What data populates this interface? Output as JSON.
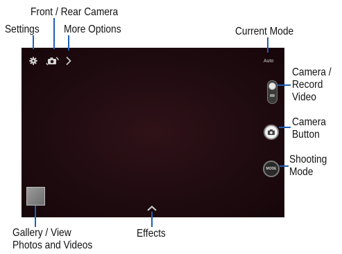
{
  "callouts": {
    "front_rear_camera": "Front / Rear Camera",
    "settings": "Settings",
    "more_options": "More Options",
    "current_mode": "Current Mode",
    "camera_record_video": [
      "Camera /",
      "Record",
      "Video"
    ],
    "camera_button": [
      "Camera",
      "Button"
    ],
    "shooting_mode": [
      "Shooting",
      "Mode"
    ],
    "gallery": [
      "Gallery / View",
      "Photos and Videos"
    ],
    "effects": "Effects"
  },
  "screen": {
    "mode_text": "Auto",
    "mode_button_text": "MODE"
  },
  "icons": {
    "settings": "gear-icon",
    "switch_camera": "switch-camera-icon",
    "more_options": "chevron-right-icon",
    "effects": "chevron-up-icon",
    "camera": "camera-icon"
  },
  "colors": {
    "callout_line": "#1d5fb8",
    "viewfinder": "#1e0b10"
  }
}
